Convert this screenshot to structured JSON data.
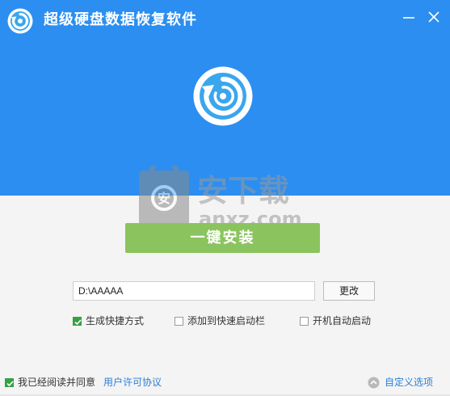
{
  "window": {
    "title": "超级硬盘数据恢复软件",
    "minimize_icon": "minimize-icon",
    "close_icon": "close-icon",
    "logo_icon": "app-logo-icon",
    "header_color": "#2b8ef0"
  },
  "hero": {
    "icon": "restore-arrow-icon"
  },
  "watermark": {
    "text_cn": "安下载",
    "text_domain": "anxz.com",
    "icon": "shield-watermark-icon"
  },
  "install": {
    "label": "一键安装",
    "color": "#8bc45e"
  },
  "path": {
    "value": "D:\\AAAAA",
    "change_label": "更改"
  },
  "options": [
    {
      "label": "生成快捷方式",
      "checked": true
    },
    {
      "label": "添加到快速启动栏",
      "checked": false
    },
    {
      "label": "开机自动启动",
      "checked": false
    }
  ],
  "footer": {
    "agree_label": "我已经阅读并同意",
    "agree_checked": true,
    "license_link": "用户许可协议",
    "custom_label": "自定义选项",
    "custom_icon": "chevron-up-circle-icon"
  }
}
